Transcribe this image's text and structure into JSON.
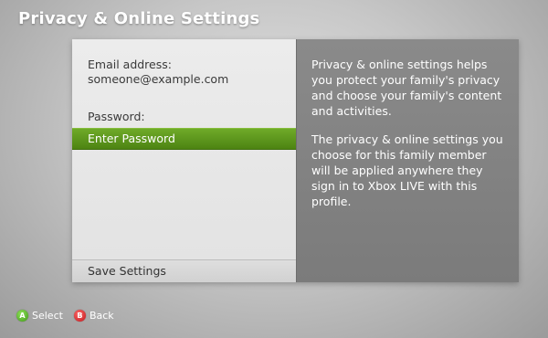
{
  "header": {
    "title": "Privacy & Online Settings"
  },
  "form": {
    "email_label": "Email address:",
    "email_value": "someone@example.com",
    "password_label": "Password:",
    "password_button": "Enter Password",
    "save_button": "Save Settings"
  },
  "description": {
    "paragraph1": "Privacy & online settings helps you protect your family's privacy and choose your family's content and activities.",
    "paragraph2": "The privacy & online settings you choose for this family member will be applied anywhere they sign in to Xbox LIVE with this profile."
  },
  "footer": {
    "a_glyph": "A",
    "a_label": "Select",
    "b_glyph": "B",
    "b_label": "Back"
  },
  "colors": {
    "accent_green": "#5e9a1e",
    "info_panel": "#828282",
    "a_button": "#3f9a15",
    "b_button": "#c0141a"
  },
  "icons": {
    "a_button": "a-button-icon",
    "b_button": "b-button-icon"
  }
}
